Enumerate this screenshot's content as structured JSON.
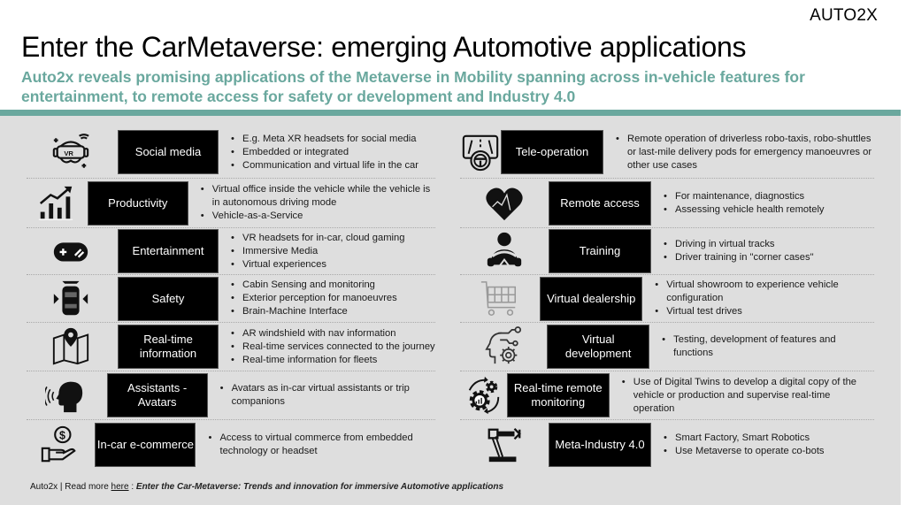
{
  "brand": "AUTO2X",
  "title": "Enter the CarMetaverse: emerging Automotive applications",
  "subtitle": "Auto2x reveals promising applications of the Metaverse in Mobility spanning across in-vehicle features for entertainment, to remote access for safety or development and Industry 4.0",
  "colors": {
    "accent": "#6aa89e",
    "panel": "#dedede",
    "box": "#000000"
  },
  "left": [
    {
      "icon": "vr-headset-icon",
      "label": "Social media",
      "bullets": [
        "E.g. Meta XR headsets for social media",
        "Embedded or integrated",
        "Communication and virtual life in the car"
      ]
    },
    {
      "icon": "growth-chart-icon",
      "label": "Productivity",
      "bullets": [
        "Virtual office inside the vehicle while the vehicle is in autonomous driving mode",
        "Vehicle-as-a-Service"
      ]
    },
    {
      "icon": "gamepad-icon",
      "label": "Entertainment",
      "bullets": [
        "VR headsets for in-car, cloud gaming",
        "Immersive Media",
        "Virtual experiences"
      ]
    },
    {
      "icon": "car-sensing-icon",
      "label": "Safety",
      "bullets": [
        "Cabin Sensing and monitoring",
        "Exterior perception for manoeuvres",
        "Brain-Machine Interface"
      ]
    },
    {
      "icon": "map-pin-icon",
      "label": "Real-time information",
      "bullets": [
        "AR windshield with nav information",
        "Real-time services connected to the journey",
        "Real-time information for fleets"
      ]
    },
    {
      "icon": "speaking-head-icon",
      "label": "Assistants - Avatars",
      "bullets": [
        "Avatars as in-car virtual assistants or trip companions"
      ]
    },
    {
      "icon": "hand-dollar-icon",
      "label": "In-car e-commerce",
      "bullets": [
        "Access to virtual commerce from embedded technology or headset"
      ]
    }
  ],
  "right": [
    {
      "icon": "steering-screen-icon",
      "label": "Tele-operation",
      "bullets": [
        "Remote operation of driverless robo-taxis, robo-shuttles or last-mile delivery pods for emergency manoeuvres or other use cases"
      ]
    },
    {
      "icon": "heart-pulse-icon",
      "label": "Remote access",
      "bullets": [
        "For maintenance, diagnostics",
        "Assessing vehicle health remotely"
      ]
    },
    {
      "icon": "driver-icon",
      "label": "Training",
      "bullets": [
        "Driving in virtual tracks",
        "Driver training in \"corner cases\""
      ]
    },
    {
      "icon": "shopping-cart-icon",
      "label": "Virtual dealership",
      "bullets": [
        "Virtual showroom to experience vehicle configuration",
        "Virtual test drives"
      ]
    },
    {
      "icon": "head-gear-circuit-icon",
      "label": "Virtual development",
      "bullets": [
        "Testing, development of features and functions"
      ]
    },
    {
      "icon": "gears-cycle-icon",
      "label": "Real-time remote monitoring",
      "bullets": [
        "Use of Digital Twins to develop a digital copy of the vehicle or production and supervise real-time operation"
      ]
    },
    {
      "icon": "robot-arm-icon",
      "label": "Meta-Industry 4.0",
      "bullets": [
        "Smart Factory, Smart Robotics",
        "Use Metaverse to operate co-bots"
      ]
    }
  ],
  "footer": {
    "prefix": "Auto2x | Read more ",
    "link": "here",
    "sep": " : ",
    "article": "Enter the Car-Metaverse: Trends and innovation for immersive Automotive applications"
  }
}
